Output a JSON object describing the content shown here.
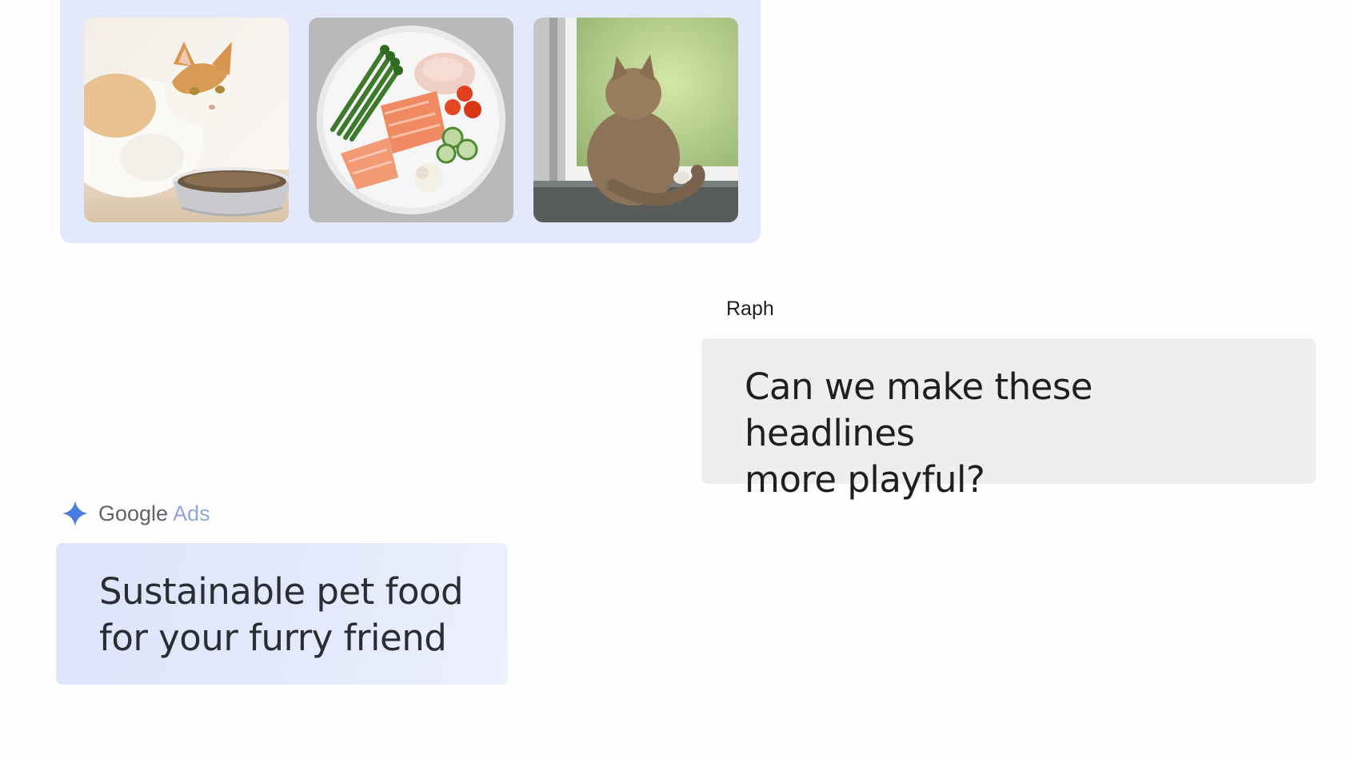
{
  "gallery": {
    "images": [
      {
        "alt": "cat-eating-from-bowl"
      },
      {
        "alt": "plate-of-salmon-chicken-vegetables"
      },
      {
        "alt": "cat-looking-out-window"
      }
    ]
  },
  "user_message": {
    "sender": "Raph",
    "text": "Can we make these headlines\nmore playful?"
  },
  "assistant_message": {
    "brand_part1": "Google",
    "brand_part2": " Ads",
    "icon": "sparkle-icon",
    "text": "Sustainable pet food\nfor your furry friend"
  },
  "colors": {
    "gallery_bg": "#e3e9fb",
    "user_bubble_bg": "#eeeeef",
    "assistant_bubble_bg": "#dde5fb",
    "sparkle": "#4a7fe0"
  }
}
